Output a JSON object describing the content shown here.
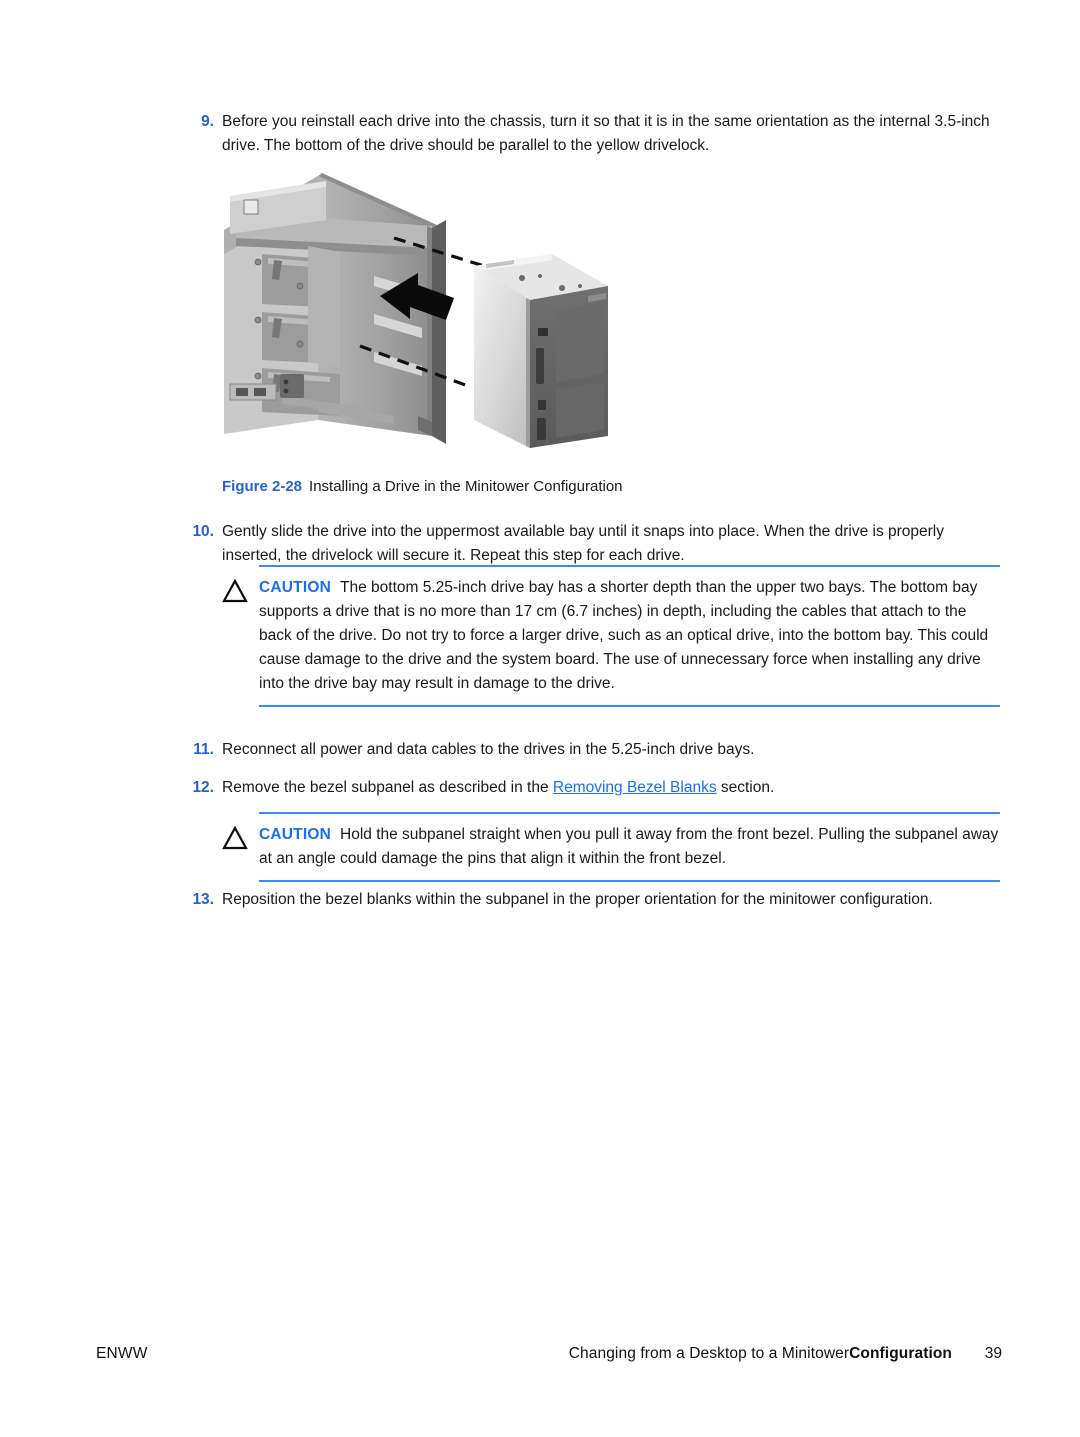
{
  "colors": {
    "step_number": "#2463d4",
    "caution_keyword": "#1a6ef0",
    "rule": "#3a8ef0",
    "link": "#1a6ef0",
    "body_text": "#1a1a1a"
  },
  "steps": [
    {
      "number": "9.",
      "text": "Before you reinstall each drive into the chassis, turn it so that it is in the same orientation as the internal 3.5-inch drive. The bottom of the drive should be parallel to the yellow drivelock."
    },
    {
      "number": "10.",
      "text": "Gently slide the drive into the uppermost available bay until it snaps into place. When the drive is properly inserted, the drivelock will secure it. Repeat this step for each drive."
    },
    {
      "number": "11.",
      "text": "Reconnect all power and data cables to the drives in the 5.25-inch drive bays."
    },
    {
      "number": "12.",
      "text_before_link": "Remove the bezel subpanel as described in the ",
      "link_text": "Removing Bezel Blanks",
      "text_after_link": " section."
    },
    {
      "number": "13.",
      "text": "Reposition the bezel blanks within the subpanel in the proper orientation for the minitower configuration."
    }
  ],
  "figure": {
    "label": "Figure 2-28",
    "caption": "Installing a Drive in the Minitower Configuration",
    "alt": "Grayscale illustration of a computer chassis with the side removed and an optical drive being slid into an upper 5.25-inch drive bay, indicated by a black arrow and dashed alignment lines."
  },
  "cautions": [
    {
      "keyword": "CAUTION",
      "text": "The bottom 5.25-inch drive bay has a shorter depth than the upper two bays. The bottom bay supports a drive that is no more than 17 cm (6.7 inches) in depth, including the cables that attach to the back of the drive. Do not try to force a larger drive, such as an optical drive, into the bottom bay. This could cause damage to the drive and the system board. The use of unnecessary force when installing any drive into the drive bay may result in damage to the drive."
    },
    {
      "keyword": "CAUTION",
      "text": "Hold the subpanel straight when you pull it away from the front bezel. Pulling the subpanel away at an angle could damage the pins that align it within the front bezel."
    }
  ],
  "footer": {
    "left": "ENWW",
    "title_normal": "Changing from a Desktop to a Minitower",
    "title_bold": "Configuration",
    "page_number": "39"
  }
}
